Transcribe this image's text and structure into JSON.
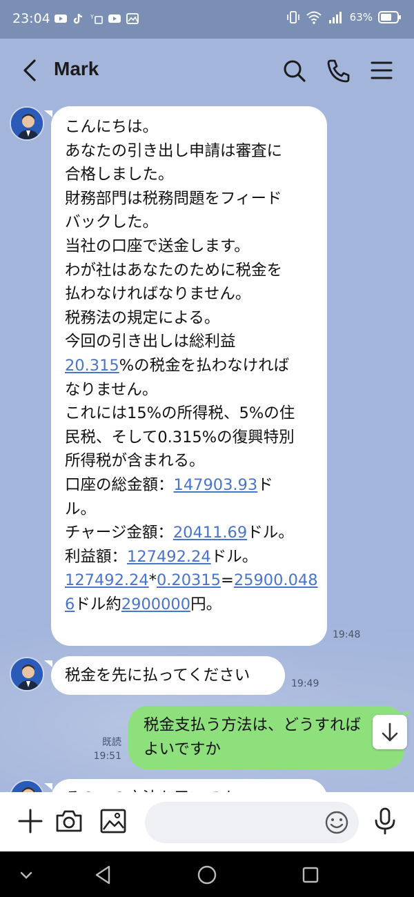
{
  "status_bar": {
    "time": "23:04",
    "battery": "63%",
    "left_icons": [
      "youtube-icon",
      "tiktok-icon",
      "call-icon",
      "youtube-icon",
      "gallery-icon"
    ],
    "right_icons": [
      "vibrate-icon",
      "wifi-icon",
      "signal-icon",
      "battery-icon"
    ]
  },
  "header": {
    "title": "Mark",
    "buttons": [
      "back-icon",
      "search-icon",
      "phone-icon",
      "menu-icon"
    ]
  },
  "messages": [
    {
      "sender": "Mark",
      "direction": "in",
      "time": "19:48",
      "lines": [
        [
          {
            "t": "こんにちは。"
          }
        ],
        [
          {
            "t": "あなたの引き出し申請は審査に"
          }
        ],
        [
          {
            "t": "合格しました。"
          }
        ],
        [
          {
            "t": "財務部門は税務問題をフィード"
          }
        ],
        [
          {
            "t": "バックした。"
          }
        ],
        [
          {
            "t": "当社の口座で送金します。"
          }
        ],
        [
          {
            "t": "わが社はあなたのために税金を"
          }
        ],
        [
          {
            "t": "払わなければなりません。"
          }
        ],
        [
          {
            "t": "税務法の規定による。"
          }
        ],
        [
          {
            "t": "今回の引き出しは総利益"
          }
        ],
        [
          {
            "t": "20.315",
            "link": true
          },
          {
            "t": "%の税金を払わなければ"
          }
        ],
        [
          {
            "t": "なりません。"
          }
        ],
        [
          {
            "t": "これには15%の所得税、5%の住"
          }
        ],
        [
          {
            "t": "民税、そして0.315%の復興特別"
          }
        ],
        [
          {
            "t": "所得税が含まれる。"
          }
        ],
        [
          {
            "t": "口座の総金額："
          },
          {
            "t": "147903.93",
            "link": true
          },
          {
            "t": "ド"
          }
        ],
        [
          {
            "t": "ル。"
          }
        ],
        [
          {
            "t": "チャージ金額："
          },
          {
            "t": "20411.69",
            "link": true
          },
          {
            "t": "ドル。"
          }
        ],
        [
          {
            "t": "利益額："
          },
          {
            "t": "127492.24",
            "link": true
          },
          {
            "t": "ドル。"
          }
        ],
        [
          {
            "t": "127492.24",
            "link": true
          },
          {
            "t": "*"
          },
          {
            "t": "0.20315",
            "link": true
          },
          {
            "t": "="
          },
          {
            "t": "25900.048",
            "link": true
          }
        ],
        [
          {
            "t": "6",
            "link": true
          },
          {
            "t": "ドル約"
          },
          {
            "t": "2900000",
            "link": true
          },
          {
            "t": "円。"
          }
        ]
      ]
    },
    {
      "sender": "Mark",
      "direction": "in",
      "time": "19:49",
      "lines": [
        [
          {
            "t": "税金を先に払ってください"
          }
        ]
      ]
    },
    {
      "sender": "me",
      "direction": "out",
      "read_label": "既読",
      "time": "19:51",
      "lines": [
        [
          {
            "t": "税金支払う方法は、どうすれば"
          }
        ],
        [
          {
            "t": "よいですか"
          }
        ]
      ]
    },
    {
      "sender": "Mark",
      "direction": "in",
      "partial": true,
      "lines": [
        [
          {
            "t": "その…の方法を用いです"
          }
        ]
      ]
    }
  ],
  "input_bar": {
    "placeholder": "",
    "buttons": [
      "plus-icon",
      "camera-icon",
      "image-icon",
      "emoji-icon",
      "microphone-icon"
    ]
  },
  "nav_bar": {
    "buttons": [
      "collapse-icon",
      "back-triangle-icon",
      "home-circle-icon",
      "recents-square-icon"
    ]
  },
  "colors": {
    "chat_bg": "#a3b5db",
    "incoming_bubble": "#ffffff",
    "outgoing_bubble": "#8ee07d",
    "link": "#4a74c9",
    "status_bar": "#7a8fb3"
  }
}
